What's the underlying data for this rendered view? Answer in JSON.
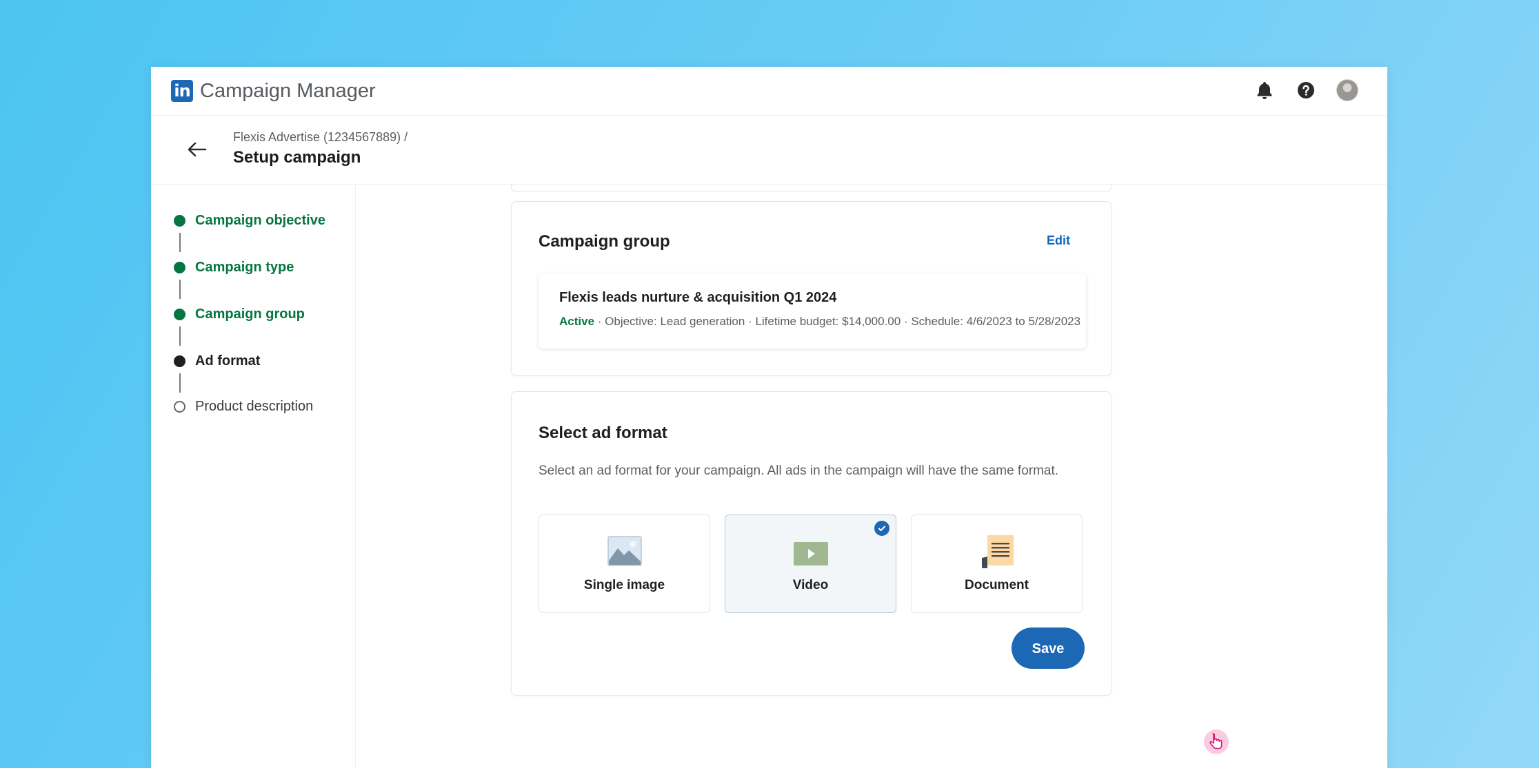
{
  "app": {
    "logo_text": "in",
    "name": "Campaign Manager"
  },
  "topbar": {
    "icons": [
      "bell-icon",
      "help-icon",
      "avatar"
    ]
  },
  "header": {
    "breadcrumb": "Flexis Advertise (1234567889) /",
    "title": "Setup campaign"
  },
  "steps": [
    {
      "label": "Campaign objective",
      "state": "done"
    },
    {
      "label": "Campaign type",
      "state": "done"
    },
    {
      "label": "Campaign group",
      "state": "done"
    },
    {
      "label": "Ad format",
      "state": "current"
    },
    {
      "label": "Product description",
      "state": "todo"
    }
  ],
  "campaign_group": {
    "title": "Campaign group",
    "edit_label": "Edit",
    "name": "Flexis leads nurture & acquisition Q1 2024",
    "status": "Active",
    "meta": " · Objective: Lead generation · Lifetime budget: $14,000.00 · Schedule: 4/6/2023 to 5/28/2023"
  },
  "ad_format": {
    "title": "Select ad format",
    "description": "Select an ad format for your campaign. All ads in the campaign will have the same format.",
    "options": [
      {
        "label": "Single image",
        "icon": "image-icon",
        "selected": false
      },
      {
        "label": "Video",
        "icon": "video-icon",
        "selected": true
      },
      {
        "label": "Document",
        "icon": "document-icon",
        "selected": false
      }
    ],
    "save_label": "Save"
  },
  "colors": {
    "brand": "#1d68b5",
    "success": "#057642",
    "background_start": "#4cc4f2",
    "background_end": "#93d8f8"
  }
}
